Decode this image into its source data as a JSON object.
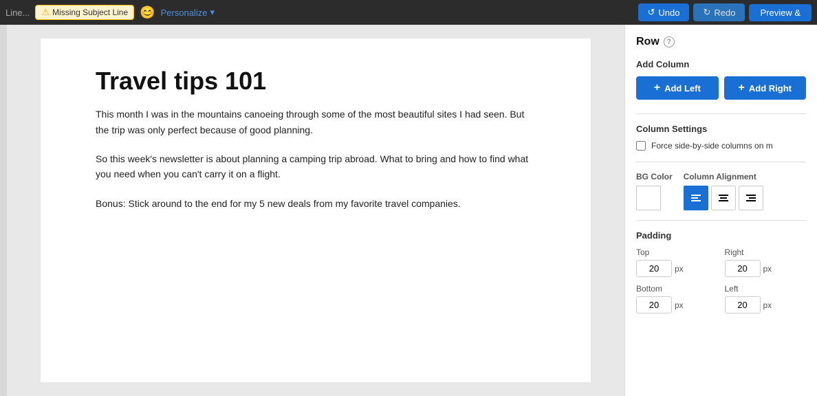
{
  "toolbar": {
    "line_placeholder": "Line...",
    "missing_subject": "Missing Subject Line",
    "emoji_icon": "😊",
    "personalize_label": "Personalize",
    "chevron": "▾",
    "undo_label": "Undo",
    "redo_label": "Redo",
    "preview_label": "Preview &"
  },
  "panel": {
    "title": "Row",
    "help_icon": "?",
    "add_column_label": "Add Column",
    "add_left_label": "Add Left",
    "add_right_label": "Add Right",
    "column_settings_label": "Column Settings",
    "force_checkbox_label": "Force side-by-side columns on m",
    "bg_color_label": "BG Color",
    "column_alignment_label": "Column Alignment",
    "padding_label": "Padding",
    "top_label": "Top",
    "right_label": "Right",
    "bottom_label": "Bottom",
    "left_label": "Left",
    "top_value": "20",
    "right_value": "20",
    "bottom_value": "20",
    "left_value": "20",
    "px": "px"
  },
  "email": {
    "title": "Travel tips 101",
    "para1": "This month I was in the mountains canoeing through some of the most beautiful sites I had seen. But the trip was only perfect because of good planning.",
    "para2": "So this week's newsletter is about planning a camping trip abroad. What to bring and how to find what you need when you can't carry it on a flight.",
    "para3": "Bonus: Stick around to the end for my 5 new deals from my favorite travel companies."
  }
}
